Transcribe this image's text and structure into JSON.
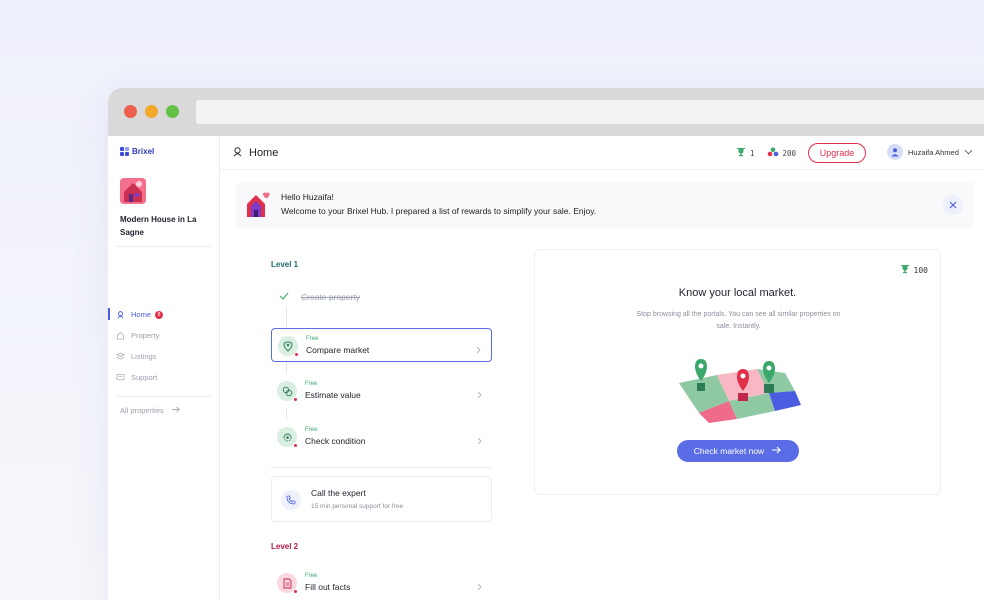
{
  "app": {
    "brand": "Brixel"
  },
  "sidebar": {
    "property_name": "Modern House in La Sagne",
    "items": [
      {
        "label": "Home",
        "badge": "8",
        "icon": "home-icon",
        "active": true
      },
      {
        "label": "Property",
        "icon": "house-icon"
      },
      {
        "label": "Listings",
        "icon": "listing-icon"
      },
      {
        "label": "Support",
        "icon": "support-icon"
      }
    ],
    "all_properties": "All properties"
  },
  "header": {
    "title": "Home",
    "trophies": "1",
    "points": "200",
    "upgrade_label": "Upgrade",
    "user_name": "Huzaifa Ahmed"
  },
  "banner": {
    "greeting": "Hello Huzaifa!",
    "message": "Welcome to your Brixel Hub. I prepared a list of rewards to simplify your sale. Enjoy."
  },
  "level1": {
    "label": "Level 1",
    "done_step": "Create property",
    "steps": [
      {
        "tag": "Free",
        "title": "Compare market",
        "icon": "map-pin-icon"
      },
      {
        "tag": "Free",
        "title": "Estimate value",
        "icon": "coins-icon"
      },
      {
        "tag": "Free",
        "title": "Check condition",
        "icon": "refresh-search-icon"
      }
    ],
    "call": {
      "title": "Call the expert",
      "subtitle": "15 min personal support for free"
    }
  },
  "level2": {
    "label": "Level 2",
    "steps": [
      {
        "tag": "Free",
        "title": "Fill out facts",
        "icon": "document-icon"
      }
    ]
  },
  "detail": {
    "points": "100",
    "title": "Know your local market.",
    "description": "Stop browsing all the portals. You can see all similar properties on sale. Instantly.",
    "button_label": "Check market now"
  },
  "colors": {
    "accent": "#5a6de6",
    "danger": "#e0304a",
    "success": "#3aa86b",
    "level1": "#1f6b6b",
    "level2": "#b21a4a"
  }
}
